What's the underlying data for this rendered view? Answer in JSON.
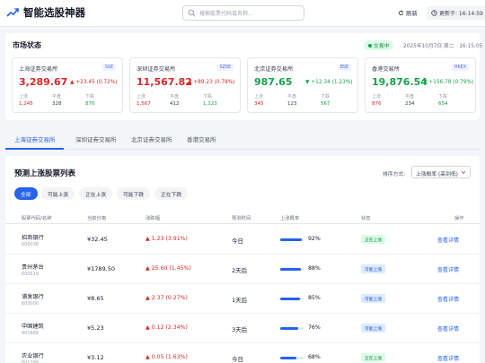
{
  "header": {
    "app_title": "智能选股神器",
    "search_placeholder": "搜索股票代码或名称...",
    "refresh_label": "刷新",
    "updated_label": "更新于: 16:14:59"
  },
  "market": {
    "title": "市场状态",
    "status": "交易中",
    "date": "2025年10月7日 周二",
    "time": "16:15:05",
    "stat_labels": {
      "up": "上涨",
      "flat": "平盘",
      "down": "下跌"
    },
    "exchanges": [
      {
        "name": "上海证券交易所",
        "tag": "SSE",
        "value": "3,289.67",
        "change": "+23.45 (0.72%)",
        "direction": "up",
        "up": "1,245",
        "flat": "328",
        "down": "876"
      },
      {
        "name": "深圳证券交易所",
        "tag": "SZSE",
        "value": "11,567.82",
        "change": "+89.23 (0.78%)",
        "direction": "up",
        "up": "1,567",
        "flat": "412",
        "down": "1,123"
      },
      {
        "name": "北京证券交易所",
        "tag": "BSE",
        "value": "987.65",
        "change": "+12.34 (1.23%)",
        "direction": "down",
        "up": "345",
        "flat": "123",
        "down": "567"
      },
      {
        "name": "香港交易所",
        "tag": "HKEX",
        "value": "19,876.54",
        "change": "+156.78 (0.79%)",
        "direction": "down",
        "up": "876",
        "flat": "234",
        "down": "654"
      }
    ]
  },
  "tabs": [
    "上海证券交易所",
    "深圳证券交易所",
    "北京证券交易所",
    "香港交易所"
  ],
  "list": {
    "title": "预测上涨股票列表",
    "sort_label": "排序方式:",
    "sort_value": "上涨概率 (高到低)",
    "filters": [
      "全部",
      "可能上涨",
      "正在上涨",
      "可能下跌",
      "正在下跌"
    ],
    "columns": [
      "股票代码/名称",
      "当前价格",
      "涨跌幅",
      "预测时间",
      "上涨概率",
      "状态",
      "操作"
    ],
    "detail_label": "查看详情",
    "rows": [
      {
        "name": "招商银行",
        "code": "600036",
        "price": "¥32.45",
        "change": "1.23 (3.91%)",
        "time": "今日",
        "prob": "92%",
        "prob_value": 92,
        "status": "正在上涨",
        "status_type": "rising"
      },
      {
        "name": "贵州茅台",
        "code": "600519",
        "price": "¥1789.50",
        "change": "25.60 (1.45%)",
        "time": "2天后",
        "prob": "88%",
        "prob_value": 88,
        "status": "可能上涨",
        "status_type": "possible"
      },
      {
        "name": "浦发银行",
        "code": "600000",
        "price": "¥8.65",
        "change": "2.37 (0.27%)",
        "time": "1天后",
        "prob": "85%",
        "prob_value": 85,
        "status": "可能上涨",
        "status_type": "possible"
      },
      {
        "name": "中国建筑",
        "code": "601668",
        "price": "¥5.23",
        "change": "0.12 (2.34%)",
        "time": "3天后",
        "prob": "76%",
        "prob_value": 76,
        "status": "可能上涨",
        "status_type": "possible"
      },
      {
        "name": "农业银行",
        "code": "601288",
        "price": "¥3.12",
        "change": "0.05 (1.63%)",
        "time": "今日",
        "prob": "68%",
        "prob_value": 68,
        "status": "正在上涨",
        "status_type": "rising"
      }
    ]
  },
  "colors": {
    "accent": "#2563eb",
    "up": "#dc2626",
    "down": "#16a34a"
  }
}
